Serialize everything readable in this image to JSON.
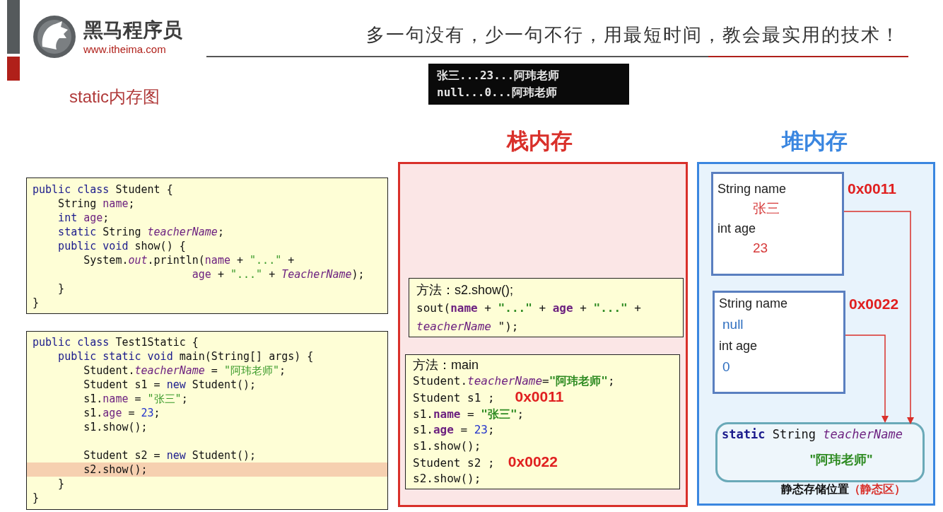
{
  "logo": {
    "name": "黑马程序员",
    "url": "www.itheima.com"
  },
  "slogan": "多一句没有，少一句不行，用最短时间，教会最实用的技术！",
  "console": {
    "lines": [
      "张三...23...阿玮老师",
      "null...0...阿玮老师"
    ]
  },
  "title": "static内存图",
  "code_blocks": [
    {
      "lines": [
        {
          "highlighted": false,
          "blank_before": false,
          "tokens": [
            {
              "text": "public class ",
              "kind": "kw"
            },
            {
              "text": "Student {",
              "kind": "plain"
            }
          ]
        },
        {
          "highlighted": false,
          "blank_before": false,
          "tokens": [
            {
              "text": "    String ",
              "kind": "plain"
            },
            {
              "text": "name",
              "kind": "field"
            },
            {
              "text": ";",
              "kind": "plain"
            }
          ]
        },
        {
          "highlighted": false,
          "blank_before": false,
          "tokens": [
            {
              "text": "    int ",
              "kind": "kw"
            },
            {
              "text": "age",
              "kind": "field"
            },
            {
              "text": ";",
              "kind": "plain"
            }
          ]
        },
        {
          "highlighted": false,
          "blank_before": false,
          "tokens": [
            {
              "text": "    static ",
              "kind": "kw"
            },
            {
              "text": "String ",
              "kind": "plain"
            },
            {
              "text": "teacherName",
              "kind": "italic_field"
            },
            {
              "text": ";",
              "kind": "plain"
            }
          ]
        },
        {
          "highlighted": false,
          "blank_before": false,
          "tokens": [
            {
              "text": "    public void ",
              "kind": "kw"
            },
            {
              "text": "show() {",
              "kind": "plain"
            }
          ]
        },
        {
          "highlighted": false,
          "blank_before": false,
          "tokens": [
            {
              "text": "        System.",
              "kind": "plain"
            },
            {
              "text": "out",
              "kind": "italic_field"
            },
            {
              "text": ".println(",
              "kind": "plain"
            },
            {
              "text": "name",
              "kind": "field"
            },
            {
              "text": " + ",
              "kind": "plain"
            },
            {
              "text": "\"...\"",
              "kind": "string"
            },
            {
              "text": " +",
              "kind": "plain"
            }
          ]
        },
        {
          "highlighted": false,
          "blank_before": false,
          "tokens": [
            {
              "text": "                         age",
              "kind": "field"
            },
            {
              "text": " + ",
              "kind": "plain"
            },
            {
              "text": "\"...\"",
              "kind": "string"
            },
            {
              "text": " + ",
              "kind": "plain"
            },
            {
              "text": "TeacherName",
              "kind": "italic_field"
            },
            {
              "text": ");",
              "kind": "plain"
            }
          ]
        },
        {
          "highlighted": false,
          "blank_before": false,
          "tokens": [
            {
              "text": "    }",
              "kind": "plain"
            }
          ]
        },
        {
          "highlighted": false,
          "blank_before": false,
          "tokens": [
            {
              "text": "}",
              "kind": "plain"
            }
          ]
        }
      ]
    },
    {
      "lines": [
        {
          "highlighted": false,
          "blank_before": false,
          "tokens": [
            {
              "text": "public class ",
              "kind": "kw"
            },
            {
              "text": "Test1Static {",
              "kind": "plain"
            }
          ]
        },
        {
          "highlighted": false,
          "blank_before": false,
          "tokens": [
            {
              "text": "    public static void ",
              "kind": "kw"
            },
            {
              "text": "main(String[] args) {",
              "kind": "plain"
            }
          ]
        },
        {
          "highlighted": false,
          "blank_before": false,
          "tokens": [
            {
              "text": "        Student.",
              "kind": "plain"
            },
            {
              "text": "teacherName",
              "kind": "italic_field"
            },
            {
              "text": " = ",
              "kind": "plain"
            },
            {
              "text": "\"阿玮老师\"",
              "kind": "string"
            },
            {
              "text": ";",
              "kind": "plain"
            }
          ]
        },
        {
          "highlighted": false,
          "blank_before": false,
          "tokens": [
            {
              "text": "        Student s1 = ",
              "kind": "plain"
            },
            {
              "text": "new ",
              "kind": "kw"
            },
            {
              "text": "Student();",
              "kind": "plain"
            }
          ]
        },
        {
          "highlighted": false,
          "blank_before": false,
          "tokens": [
            {
              "text": "        s1.",
              "kind": "plain"
            },
            {
              "text": "name",
              "kind": "field"
            },
            {
              "text": " = ",
              "kind": "plain"
            },
            {
              "text": "\"张三\"",
              "kind": "string"
            },
            {
              "text": ";",
              "kind": "plain"
            }
          ]
        },
        {
          "highlighted": false,
          "blank_before": false,
          "tokens": [
            {
              "text": "        s1.",
              "kind": "plain"
            },
            {
              "text": "age",
              "kind": "field"
            },
            {
              "text": " = ",
              "kind": "plain"
            },
            {
              "text": "23",
              "kind": "number"
            },
            {
              "text": ";",
              "kind": "plain"
            }
          ]
        },
        {
          "highlighted": false,
          "blank_before": false,
          "tokens": [
            {
              "text": "        s1.show();",
              "kind": "plain"
            }
          ]
        },
        {
          "highlighted": false,
          "blank_before": true,
          "tokens": [
            {
              "text": "        Student s2 = ",
              "kind": "plain"
            },
            {
              "text": "new ",
              "kind": "kw"
            },
            {
              "text": "Student();",
              "kind": "plain"
            }
          ]
        },
        {
          "highlighted": true,
          "blank_before": false,
          "tokens": [
            {
              "text": "        s2.show();",
              "kind": "plain"
            }
          ]
        },
        {
          "highlighted": false,
          "blank_before": false,
          "tokens": [
            {
              "text": "    }",
              "kind": "plain"
            }
          ]
        },
        {
          "highlighted": false,
          "blank_before": false,
          "tokens": [
            {
              "text": "}",
              "kind": "plain"
            }
          ]
        }
      ]
    }
  ],
  "stack": {
    "title": "栈内存",
    "frames": [
      {
        "header": "方法：s2.show();",
        "lines": [
          {
            "tokens": [
              {
                "text": "sout(",
                "kind": "plain"
              },
              {
                "text": "name",
                "kind": "field_bold"
              },
              {
                "text": " + ",
                "kind": "plain"
              },
              {
                "text": "\"...\"",
                "kind": "string_bold"
              },
              {
                "text": " + ",
                "kind": "plain"
              },
              {
                "text": "age",
                "kind": "field_bold"
              },
              {
                "text": " + ",
                "kind": "plain"
              },
              {
                "text": "\"...\"",
                "kind": "string_bold"
              },
              {
                "text": " +",
                "kind": "plain"
              }
            ]
          },
          {
            "tokens": [
              {
                "text": "teacherName",
                "kind": "italic_field"
              },
              {
                "text": " \");",
                "kind": "plain"
              }
            ]
          }
        ]
      },
      {
        "header": "方法：main",
        "lines": [
          {
            "tokens": [
              {
                "text": "Student.",
                "kind": "plain"
              },
              {
                "text": "teacherName",
                "kind": "italic_field"
              },
              {
                "text": "=",
                "kind": "plain"
              },
              {
                "text": "\"阿玮老师\"",
                "kind": "string_bold"
              },
              {
                "text": ";",
                "kind": "plain"
              }
            ]
          },
          {
            "tokens": [
              {
                "text": "Student s1 ;   ",
                "kind": "plain"
              },
              {
                "text": "0x0011",
                "kind": "address"
              }
            ]
          },
          {
            "tokens": [
              {
                "text": "s1.",
                "kind": "plain"
              },
              {
                "text": "name",
                "kind": "field_bold"
              },
              {
                "text": " = ",
                "kind": "plain"
              },
              {
                "text": "\"张三\"",
                "kind": "string_bold"
              },
              {
                "text": ";",
                "kind": "plain"
              }
            ]
          },
          {
            "tokens": [
              {
                "text": "s1.",
                "kind": "plain"
              },
              {
                "text": "age",
                "kind": "field_bold"
              },
              {
                "text": " = ",
                "kind": "plain"
              },
              {
                "text": "23",
                "kind": "number"
              },
              {
                "text": ";",
                "kind": "plain"
              }
            ]
          },
          {
            "tokens": [
              {
                "text": "s1.show();",
                "kind": "plain"
              }
            ]
          },
          {
            "tokens": [
              {
                "text": "Student s2 ;  ",
                "kind": "plain"
              },
              {
                "text": "0x0022",
                "kind": "address"
              }
            ]
          },
          {
            "tokens": [
              {
                "text": "s2.show();",
                "kind": "plain"
              }
            ]
          }
        ]
      }
    ]
  },
  "heap": {
    "title": "堆内存",
    "objects": [
      {
        "address": "0x0011",
        "color": "#d63a3a",
        "fields": [
          {
            "label": "String name",
            "value": "张三"
          },
          {
            "label": "int age",
            "value": "23"
          }
        ]
      },
      {
        "address": "0x0022",
        "color": "#2f6fc0",
        "fields": [
          {
            "label": "String name",
            "value": "null"
          },
          {
            "label": "int age",
            "value": "0"
          }
        ]
      }
    ],
    "static_area": {
      "declaration": [
        {
          "text": "static ",
          "kind": "kw_bold"
        },
        {
          "text": "String ",
          "kind": "plain"
        },
        {
          "text": "teacherName",
          "kind": "italic_field"
        }
      ],
      "value": "\"阿玮老师\""
    },
    "caption": "静态存储位置",
    "caption_note": "（静态区）"
  }
}
